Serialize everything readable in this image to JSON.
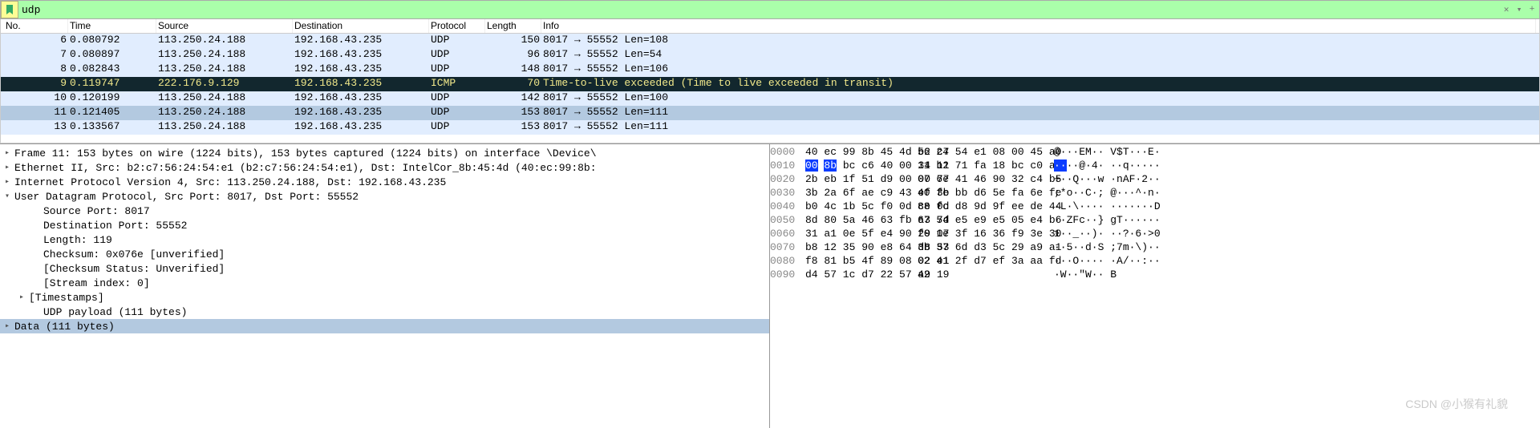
{
  "filter": {
    "value": "udp",
    "icon_name": "filter-bookmark-icon"
  },
  "columns": [
    "No.",
    "Time",
    "Source",
    "Destination",
    "Protocol",
    "Length",
    "Info"
  ],
  "rows": [
    {
      "no": "6",
      "time": "0.080792",
      "src": "113.250.24.188",
      "dst": "192.168.43.235",
      "proto": "UDP",
      "len": "150",
      "info": "8017 → 55552 Len=108",
      "cls": ""
    },
    {
      "no": "7",
      "time": "0.080897",
      "src": "113.250.24.188",
      "dst": "192.168.43.235",
      "proto": "UDP",
      "len": "96",
      "info": "8017 → 55552 Len=54",
      "cls": ""
    },
    {
      "no": "8",
      "time": "0.082843",
      "src": "113.250.24.188",
      "dst": "192.168.43.235",
      "proto": "UDP",
      "len": "148",
      "info": "8017 → 55552 Len=106",
      "cls": ""
    },
    {
      "no": "9",
      "time": "0.119747",
      "src": "222.176.9.129",
      "dst": "192.168.43.235",
      "proto": "ICMP",
      "len": "70",
      "info": "Time-to-live exceeded (Time to live exceeded in transit)",
      "cls": "dark"
    },
    {
      "no": "10",
      "time": "0.120199",
      "src": "113.250.24.188",
      "dst": "192.168.43.235",
      "proto": "UDP",
      "len": "142",
      "info": "8017 → 55552 Len=100",
      "cls": ""
    },
    {
      "no": "11",
      "time": "0.121405",
      "src": "113.250.24.188",
      "dst": "192.168.43.235",
      "proto": "UDP",
      "len": "153",
      "info": "8017 → 55552 Len=111",
      "cls": "sel"
    },
    {
      "no": "13",
      "time": "0.133567",
      "src": "113.250.24.188",
      "dst": "192.168.43.235",
      "proto": "UDP",
      "len": "153",
      "info": "8017 → 55552 Len=111",
      "cls": ""
    }
  ],
  "tree": [
    {
      "caret": ">",
      "text": "Frame 11: 153 bytes on wire (1224 bits), 153 bytes captured (1224 bits) on interface \\Device\\",
      "indent": 0,
      "sel": false
    },
    {
      "caret": ">",
      "text": "Ethernet II, Src: b2:c7:56:24:54:e1 (b2:c7:56:24:54:e1), Dst: IntelCor_8b:45:4d (40:ec:99:8b:",
      "indent": 0,
      "sel": false
    },
    {
      "caret": ">",
      "text": "Internet Protocol Version 4, Src: 113.250.24.188, Dst: 192.168.43.235",
      "indent": 0,
      "sel": false
    },
    {
      "caret": "v",
      "text": "User Datagram Protocol, Src Port: 8017, Dst Port: 55552",
      "indent": 0,
      "sel": false
    },
    {
      "caret": "",
      "text": "Source Port: 8017",
      "indent": 2,
      "sel": false
    },
    {
      "caret": "",
      "text": "Destination Port: 55552",
      "indent": 2,
      "sel": false
    },
    {
      "caret": "",
      "text": "Length: 119",
      "indent": 2,
      "sel": false
    },
    {
      "caret": "",
      "text": "Checksum: 0x076e [unverified]",
      "indent": 2,
      "sel": false
    },
    {
      "caret": "",
      "text": "[Checksum Status: Unverified]",
      "indent": 2,
      "sel": false
    },
    {
      "caret": "",
      "text": "[Stream index: 0]",
      "indent": 2,
      "sel": false
    },
    {
      "caret": ">",
      "text": "[Timestamps]",
      "indent": 1,
      "sel": false
    },
    {
      "caret": "",
      "text": "UDP payload (111 bytes)",
      "indent": 2,
      "sel": false
    },
    {
      "caret": ">",
      "text": "Data (111 bytes)",
      "indent": 0,
      "sel": true
    }
  ],
  "hex": [
    {
      "off": "0000",
      "g1": "40 ec 99 8b 45 4d b2 c7",
      "g2": "56 24 54 e1 08 00 45 a0",
      "asc": "@···EM·· V$T···E·",
      "hl": []
    },
    {
      "off": "0010",
      "g1": "00 8b bc c6 40 00 34 11",
      "g2": "11 b2 71 fa 18 bc c0 a8",
      "asc": "····@·4· ··q·····",
      "hl": [
        0,
        1
      ]
    },
    {
      "off": "0020",
      "g1": "2b eb 1f 51 d9 00 00 77",
      "g2": "07 6e 41 46 90 32 c4 b5",
      "asc": "+··Q···w ·nAF·2··",
      "hl": []
    },
    {
      "off": "0030",
      "g1": "3b 2a 6f ae c9 43 ef 3b",
      "g2": "40 fe bb d6 5e fa 6e fe",
      "asc": ";*o··C·; @···^·n·",
      "hl": []
    },
    {
      "off": "0040",
      "g1": "b0 4c 1b 5c f0 0d ce 0d",
      "g2": "88 fc d8 9d 9f ee de 44",
      "asc": "·L·\\···· ·······D",
      "hl": []
    },
    {
      "off": "0050",
      "g1": "8d 80 5a 46 63 fb a3 7d",
      "g2": "67 54 e5 e9 e5 05 e4 b6",
      "asc": "··ZFc··} gT······",
      "hl": []
    },
    {
      "off": "0060",
      "g1": "31 a1 0e 5f e4 90 29 07",
      "g2": "f0 1e 3f 16 36 f9 3e 30",
      "asc": "1··_··)· ··?·6·>0",
      "hl": []
    },
    {
      "off": "0070",
      "g1": "b8 12 35 90 e8 64 d8 53",
      "g2": "3b 37 6d d3 5c 29 a9 a1",
      "asc": "··5··d·S ;7m·\\)··",
      "hl": []
    },
    {
      "off": "0080",
      "g1": "f8 81 b5 4f 89 08 02 e1",
      "g2": "02 41 2f d7 ef 3a aa fd",
      "asc": "···O···· ·A/··:··",
      "hl": []
    },
    {
      "off": "0090",
      "g1": "d4 57 1c d7 22 57 a9 19",
      "g2": "42",
      "asc": "·W··\"W·· B",
      "hl": []
    }
  ],
  "watermark": "CSDN @小猴有礼貌"
}
